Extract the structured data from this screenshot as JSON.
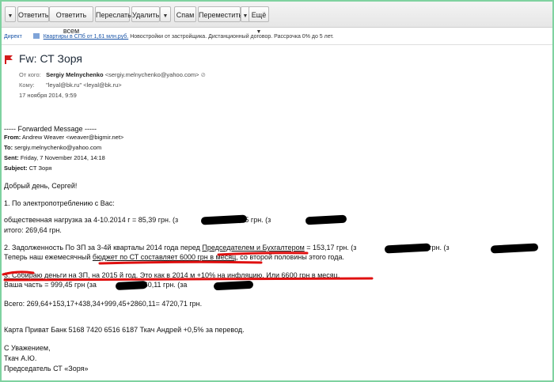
{
  "toolbar": {
    "buttons": [
      "Ответить",
      "Ответить всем",
      "Переслать",
      "Удалить",
      "Спам",
      "Переместить",
      "Ещё"
    ]
  },
  "ad": {
    "tag": "Директ",
    "link": "Квартиры в СПб от 1,61 млн.руб.",
    "text": "Новостройки от застройщика. Дистанционный договор. Рассрочка 0% до 5 лет."
  },
  "message": {
    "subject": "Fw: СТ Зоря",
    "from_label": "От кого:",
    "from_name": "Sergiy Melnychenko",
    "from_email": "<sergiy.melnychenko@yahoo.com>",
    "to_label": "Кому:",
    "to_value": "\"leyal@bk.ru\" <leyal@bk.ru>",
    "date": "17 ноября 2014, 9:59"
  },
  "forward": {
    "title": "----- Forwarded Message -----",
    "from_label": "From:",
    "from_value": "Andrew Weaver <weaver@bigmir.net>",
    "to_label": "To:",
    "to_value": "sergiy.melnychenko@yahoo.com",
    "sent_label": "Sent:",
    "sent_value": "Friday, 7 November 2014, 14:18",
    "subject_label": "Subject:",
    "subject_value": "СТ Зоря"
  },
  "body": {
    "greeting": "Добрый день, Сергей!",
    "p1_title": "1. По электропотреблению с Вас:",
    "p1_line1a": "общественная нагрузка за 4-10.2014 г = 85,39 грн. (з",
    "p1_line1b": "+ 184,25 грн. (з",
    "p1_total": "итого: 269,64 грн.",
    "p2_a": "2. Задолженность По ЗП за 3-4й кварталы 2014 года перед ",
    "p2_u": "Председателем и Бухгалтером",
    "p2_b": " = 153,17 грн. (з",
    "p2_c": "+ 438,34 грн. (з",
    "p2_line2a": "Теперь наш ежемесячный ",
    "p2_line2u": "бюджет по СТ составляет 6000 грн в месяц",
    "p2_line2b": ", со второй половины этого года.",
    "p3_line1": "3. Собираю деньги на ЗП, на 2015 й год. Это как в 2014 м +10% на инфляцию. Или 6600 грн в месяц.",
    "p3_line2a": "Ваша часть = 999,45 грн (за",
    "p3_line2b": "+ 2860,11 грн. (за",
    "total": "Всего: 269,64+153,17+438,34+999,45+2860,11= 4720,71 грн.",
    "card": "Карта Приват Банк 5168 7420 6516 6187 Ткач Андрей +0,5% за перевод.",
    "sign1": "С Уважением,",
    "sign2": "Ткач А.Ю.",
    "sign3": "Председатель СТ «Зоря»"
  }
}
